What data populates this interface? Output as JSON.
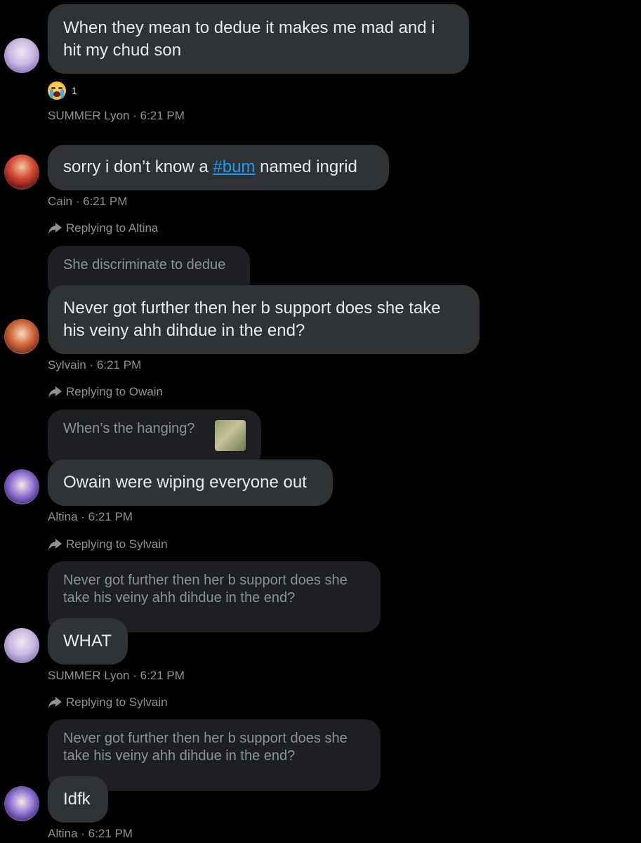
{
  "messages": [
    {
      "bubble_lines": "When they mean to dedue it makes me mad and i\nhit my chud son",
      "reaction": {
        "emoji": "loudly-crying-face-icon",
        "count": "1"
      },
      "author": "SUMMER Lyon",
      "time": "6:21 PM"
    },
    {
      "text_before": "sorry i don’t know a ",
      "hashtag": "#bum",
      "text_after": " named ingrid",
      "author": "Cain",
      "time": "6:21 PM"
    },
    {
      "reply_label": "Replying to Altina",
      "quote": "She discriminate to dedue",
      "bubble_lines": "Never got further then her b support does she take\nhis veiny ahh dihdue in the end?",
      "author": "Sylvain",
      "time": "6:21 PM"
    },
    {
      "reply_label": "Replying to Owain",
      "quote": "When’s the hanging?",
      "bubble_lines": "Owain were wiping everyone out",
      "author": "Altina",
      "time": "6:21 PM"
    },
    {
      "reply_label": "Replying to Sylvain",
      "quote": "Never got further then her b support does she\ntake his veiny ahh dihdue in the end?",
      "bubble_lines": "WHAT",
      "author": "SUMMER Lyon",
      "time": "6:21 PM"
    },
    {
      "reply_label": "Replying to Sylvain",
      "quote": "Never got further then her b support does she\ntake his veiny ahh dihdue in the end?",
      "bubble_lines": "Idfk",
      "author": "Altina",
      "time": "6:21 PM"
    }
  ],
  "separator": " · ",
  "colors": {
    "background": "#000000",
    "bubble": "#2f3336",
    "quote": "#1d1f23",
    "meta": "#8b9298",
    "hashtag": "#1d9bf0"
  }
}
